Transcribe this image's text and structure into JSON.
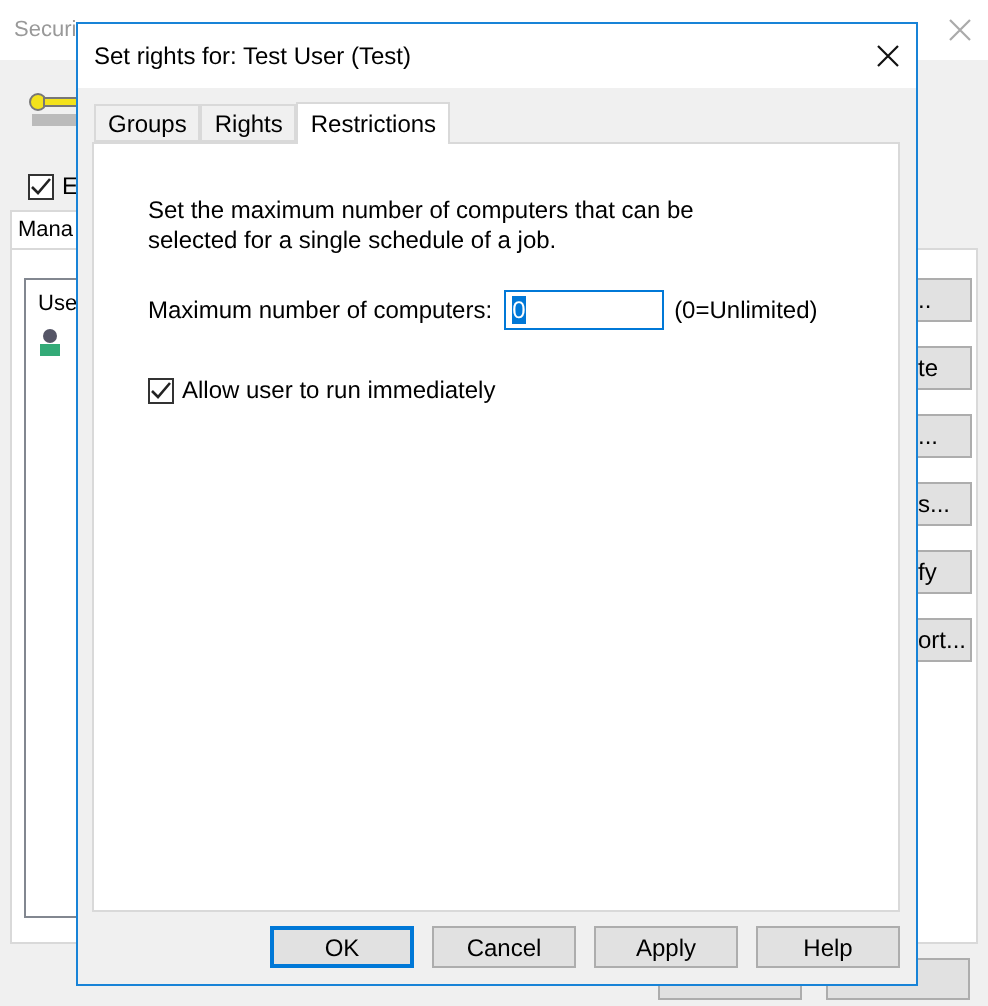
{
  "background_window": {
    "title": "Securi",
    "enable_checkbox": {
      "label": "E",
      "checked": true
    },
    "tabs": [
      {
        "label": "Mana",
        "selected": true
      }
    ],
    "list_header": "Use",
    "list_items": [
      {
        "kind": "user"
      }
    ],
    "side_buttons": [
      "..",
      "te",
      "...",
      "s...",
      "fy",
      "ort..."
    ],
    "footer_buttons": [
      {
        "kind": "button"
      },
      {
        "kind": "button"
      }
    ]
  },
  "dialog": {
    "title": "Set rights for: Test User (Test)",
    "tabs": [
      {
        "label": "Groups",
        "selected": false
      },
      {
        "label": "Rights",
        "selected": false
      },
      {
        "label": "Restrictions",
        "selected": true
      }
    ],
    "description": "Set the maximum number of computers that can be selected for a single schedule of a job.",
    "max_computers": {
      "label": "Maximum number of computers:",
      "value": "0",
      "hint": "(0=Unlimited)"
    },
    "allow_run": {
      "label": "Allow user to run immediately",
      "checked": true
    },
    "buttons": [
      {
        "label": "OK",
        "default": true
      },
      {
        "label": "Cancel",
        "default": false
      },
      {
        "label": "Apply",
        "default": false
      },
      {
        "label": "Help",
        "default": false
      }
    ]
  }
}
